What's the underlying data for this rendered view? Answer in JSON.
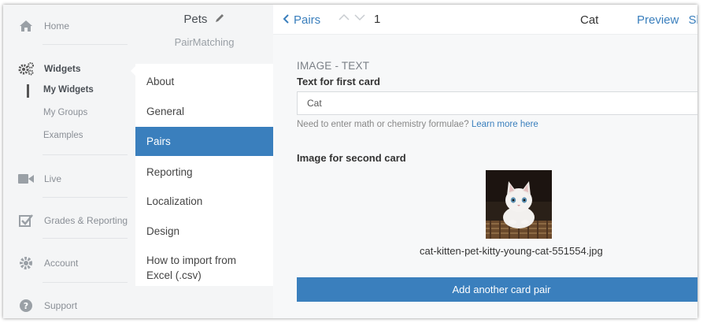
{
  "nav": {
    "home": "Home",
    "widgets": "Widgets",
    "my_widgets": "My Widgets",
    "my_groups": "My Groups",
    "examples": "Examples",
    "live": "Live",
    "grades": "Grades & Reporting",
    "account": "Account",
    "support": "Support"
  },
  "widget": {
    "title": "Pets",
    "type": "PairMatching"
  },
  "menu": {
    "items": [
      "About",
      "General",
      "Pairs",
      "Reporting",
      "Localization",
      "Design",
      "How to import from Excel (.csv)"
    ],
    "active": "Pairs"
  },
  "topbar": {
    "back_label": "Pairs",
    "pair_number": "1",
    "item_title": "Cat",
    "preview_label": "Preview",
    "share_label_partial": "Sh"
  },
  "editor": {
    "section_title": "IMAGE - TEXT",
    "first_card_label": "Text for first card",
    "first_card_value": "Cat",
    "help_text": "Need to enter math or chemistry formulae?",
    "help_link": "Learn more here",
    "second_card_label": "Image for second card",
    "image_filename": "cat-kitten-pet-kitty-young-cat-551554.jpg",
    "add_button": "Add another card pair"
  },
  "colors": {
    "accent": "#3a7fbd",
    "nav_bg": "#f4f5f6",
    "text_muted": "#8a8f96"
  }
}
